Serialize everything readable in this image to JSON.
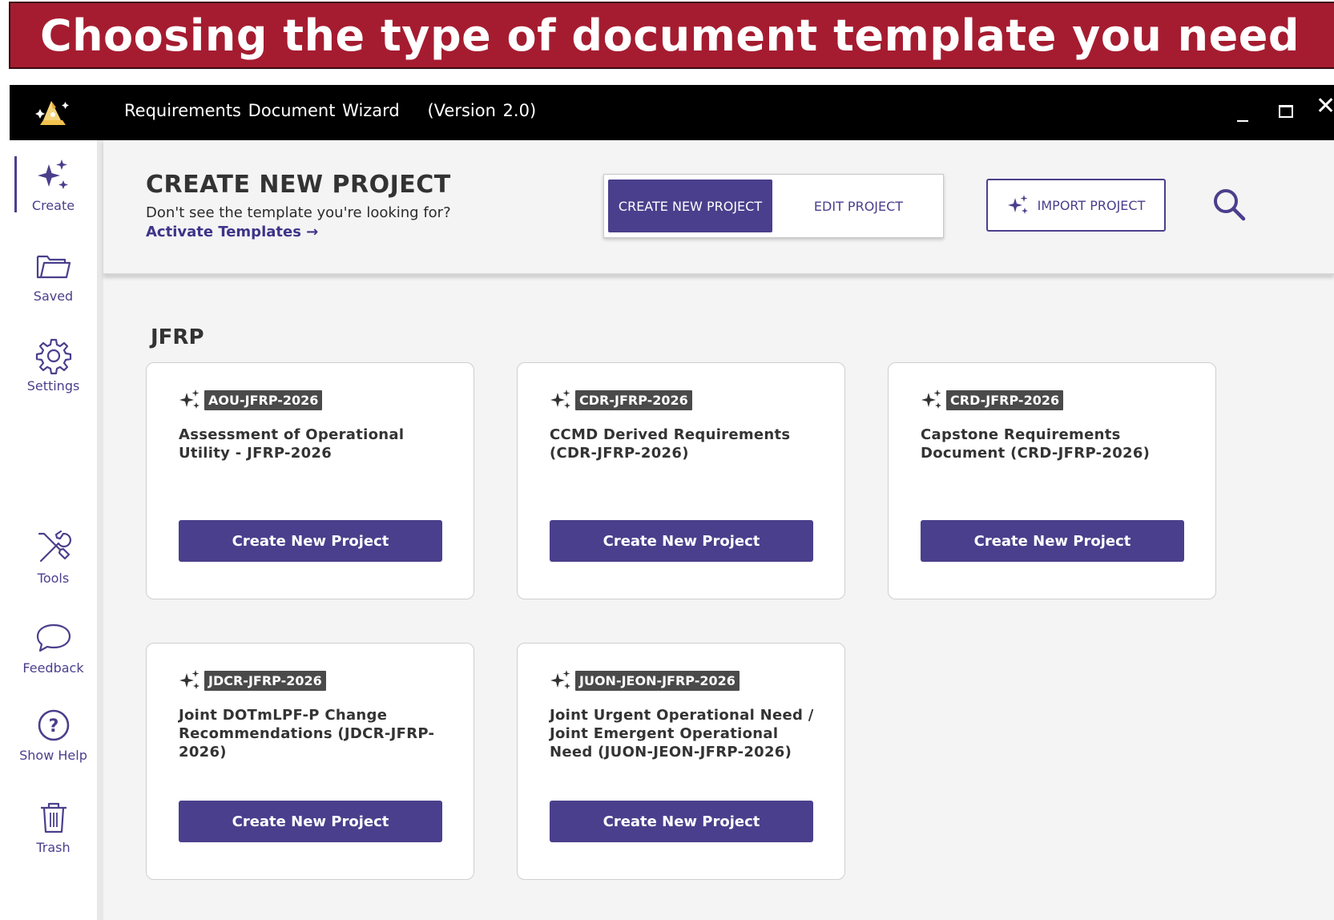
{
  "banner": {
    "title": "Choosing the type of document template you need"
  },
  "window": {
    "title": "Requirements Document Wizard",
    "version": "(Version 2.0)",
    "controls": {
      "minimize": "minimize-icon",
      "maximize": "maximize-icon",
      "close": "close-icon"
    }
  },
  "sidebar": {
    "items": [
      {
        "label": "Create",
        "icon": "sparkles-icon",
        "active": true
      },
      {
        "label": "Saved",
        "icon": "folder-icon"
      },
      {
        "label": "Settings",
        "icon": "gear-icon"
      },
      {
        "label": "Tools",
        "icon": "tools-icon"
      },
      {
        "label": "Feedback",
        "icon": "chat-bubble-icon"
      },
      {
        "label": "Show Help",
        "icon": "help-circle-icon"
      },
      {
        "label": "Trash",
        "icon": "trash-icon"
      }
    ]
  },
  "header": {
    "title": "CREATE NEW PROJECT",
    "subtitle": "Don't see the template you're looking for?",
    "link": "Activate Templates →",
    "tabs": {
      "active": "CREATE NEW PROJECT",
      "inactive": "EDIT PROJECT"
    },
    "import_button": "IMPORT PROJECT"
  },
  "section": {
    "title": "JFRP",
    "cards": [
      {
        "tag": "AOU-JFRP-2026",
        "name": "Assessment of Operational Utility - JFRP-2026",
        "button": "Create New Project"
      },
      {
        "tag": "CDR-JFRP-2026",
        "name": "CCMD Derived Requirements (CDR-JFRP-2026)",
        "button": "Create New Project"
      },
      {
        "tag": "CRD-JFRP-2026",
        "name": "Capstone Requirements Document (CRD-JFRP-2026)",
        "button": "Create New Project"
      },
      {
        "tag": "JDCR-JFRP-2026",
        "name": "Joint DOTmLPF-P Change Recommendations (JDCR-JFRP-2026)",
        "button": "Create New Project"
      },
      {
        "tag": "JUON-JEON-JFRP-2026",
        "name": "Joint Urgent Operational Need / Joint Emergent Operational Need (JUON-JEON-JFRP-2026)",
        "button": "Create New Project"
      }
    ]
  },
  "colors": {
    "brand": "#4a3f8c",
    "banner": "#a51c30",
    "titlebar": "#000000"
  }
}
